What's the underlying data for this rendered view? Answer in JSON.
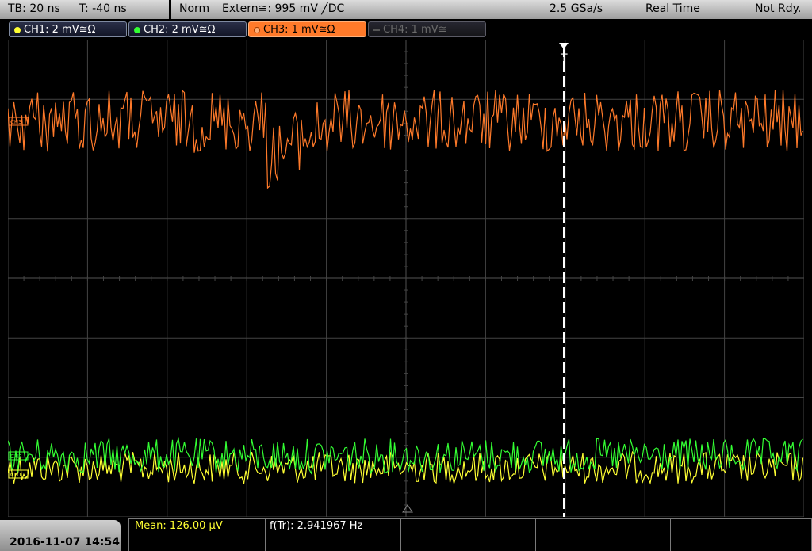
{
  "status_bar": {
    "timebase": "TB: 20 ns",
    "trigger_time": "T: -40 ns",
    "mode": "Norm",
    "trigger_source": "Extern≅: 995 mV ╱DC",
    "sample_rate": "2.5 GSa/s",
    "acquisition": "Real Time",
    "ready_state": "Not Rdy."
  },
  "channels": [
    {
      "label": "CH1: 2 mV≅Ω",
      "color": "#ffff33",
      "state": "on"
    },
    {
      "label": "CH2: 2 mV≅Ω",
      "color": "#33ff33",
      "state": "on"
    },
    {
      "label": "CH3: 1 mV≅Ω",
      "color": "#ff7a2a",
      "state": "active"
    },
    {
      "label": "CH4: 1 mV≅",
      "color": "#666666",
      "state": "off"
    }
  ],
  "trigger_marker": "T",
  "channel_markers": {
    "ch1": "CH1",
    "ch2": "CH2",
    "ch3": "CH3"
  },
  "timestamp": "2016-11-07 14:54",
  "measurements": {
    "mean": "Mean: 126.00 µV",
    "freq": "f(Tr): 2.941967 Hz"
  },
  "colors": {
    "grid": "#444444",
    "ch1": "#ffff33",
    "ch2": "#33ff33",
    "ch3": "#ff7a2a",
    "mean_text": "#ffff33"
  }
}
